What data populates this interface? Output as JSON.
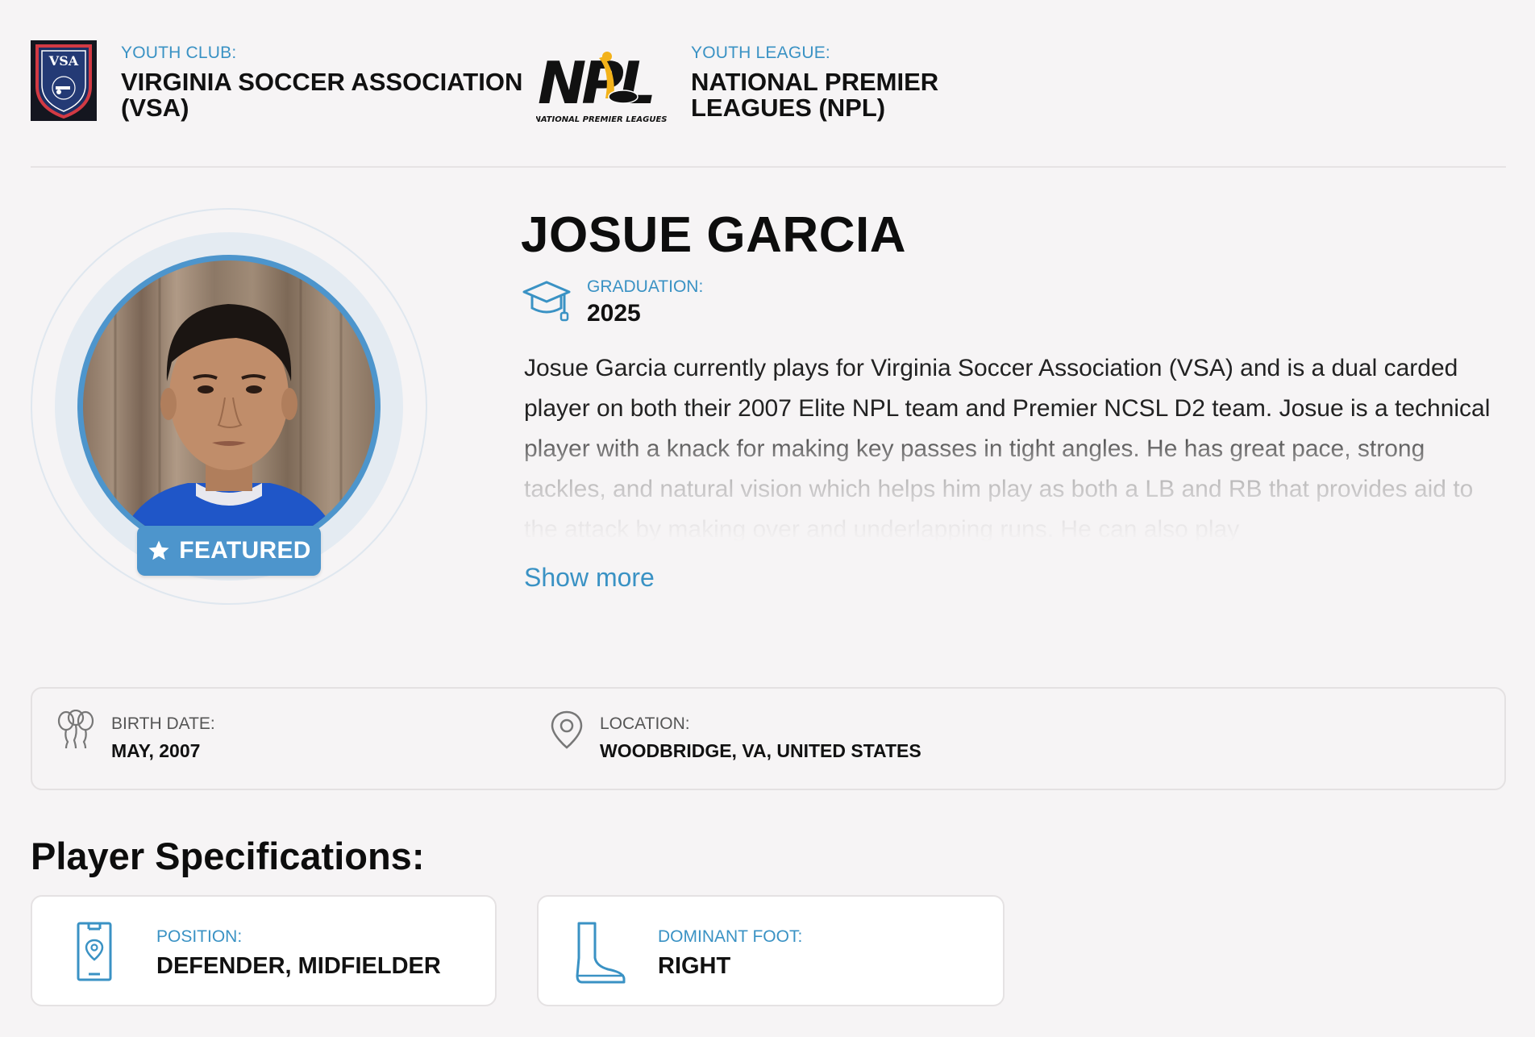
{
  "affiliations": {
    "club": {
      "label": "YOUTH CLUB:",
      "name_line1": "VIRGINIA SOCCER ASSOCIATION",
      "name_line2": "(VSA)",
      "logo_text": "VSA"
    },
    "league": {
      "label": "YOUTH LEAGUE:",
      "name_line1": "NATIONAL PREMIER",
      "name_line2": "LEAGUES (NPL)",
      "logo_text": "NPL",
      "logo_subtext": "NATIONAL PREMIER LEAGUES"
    }
  },
  "player": {
    "name": "JOSUE GARCIA",
    "badge": "FEATURED",
    "graduation_label": "GRADUATION:",
    "graduation_year": "2025",
    "bio": "Josue Garcia currently plays for Virginia Soccer Association (VSA) and is a dual carded player on both their 2007 Elite NPL team and Premier NCSL D2 team. Josue is a technical player with a knack for making key passes in tight angles. He has great pace, strong tackles, and natural vision which helps him play as both a LB and RB that provides aid to the attack by making over and underlapping runs. He can also play",
    "show_more": "Show more"
  },
  "info": {
    "birth_label": "BIRTH DATE:",
    "birth_value": "MAY, 2007",
    "location_label": "LOCATION:",
    "location_value": "WOODBRIDGE, VA, UNITED STATES"
  },
  "specs": {
    "title": "Player Specifications:",
    "position_label": "POSITION:",
    "position_value": "DEFENDER, MIDFIELDER",
    "foot_label": "DOMINANT FOOT:",
    "foot_value": "RIGHT"
  },
  "colors": {
    "accent": "#3a92c4",
    "photo_ring": "#4d95cc",
    "background": "#f6f4f5"
  }
}
